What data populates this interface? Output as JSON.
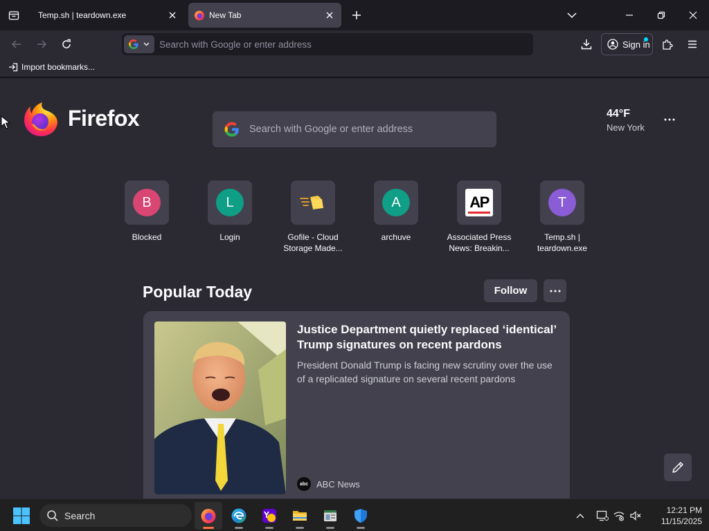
{
  "tabs": [
    {
      "title": "Temp.sh | teardown.exe",
      "active": false
    },
    {
      "title": "New Tab",
      "active": true
    }
  ],
  "navbar": {
    "url_placeholder": "Search with Google or enter address",
    "signin_label": "Sign in"
  },
  "bookmarks": {
    "import_label": "Import bookmarks..."
  },
  "newtab": {
    "brand": "Firefox",
    "search_placeholder": "Search with Google or enter address",
    "weather": {
      "temp": "44°F",
      "city": "New York"
    },
    "shortcuts": [
      {
        "label": "Blocked",
        "letter": "B",
        "color": "#d94673"
      },
      {
        "label": "Login",
        "letter": "L",
        "color": "#0f9e86"
      },
      {
        "label": "Gofile - Cloud Storage Made...",
        "letter": "",
        "color": ""
      },
      {
        "label": "archuve",
        "letter": "A",
        "color": "#0f9e86"
      },
      {
        "label": "Associated Press News: Breakin...",
        "letter": "AP",
        "color": ""
      },
      {
        "label": "Temp.sh | teardown.exe",
        "letter": "T",
        "color": "#8a5cd6"
      }
    ],
    "popular": {
      "title": "Popular Today",
      "follow_label": "Follow",
      "story": {
        "headline": "Justice Department quietly replaced ‘identical’ Trump signatures on recent pardons",
        "excerpt": "President Donald Trump is facing new scrutiny over the use of a replicated signature on several recent pardons",
        "source": "ABC News",
        "source_logo": "abc"
      }
    }
  },
  "taskbar": {
    "search_label": "Search",
    "time": "12:21 PM",
    "date": "11/15/2025"
  },
  "colors": {
    "accent": "#ff7139",
    "surface": "#42414d",
    "background": "#2b2a33"
  }
}
